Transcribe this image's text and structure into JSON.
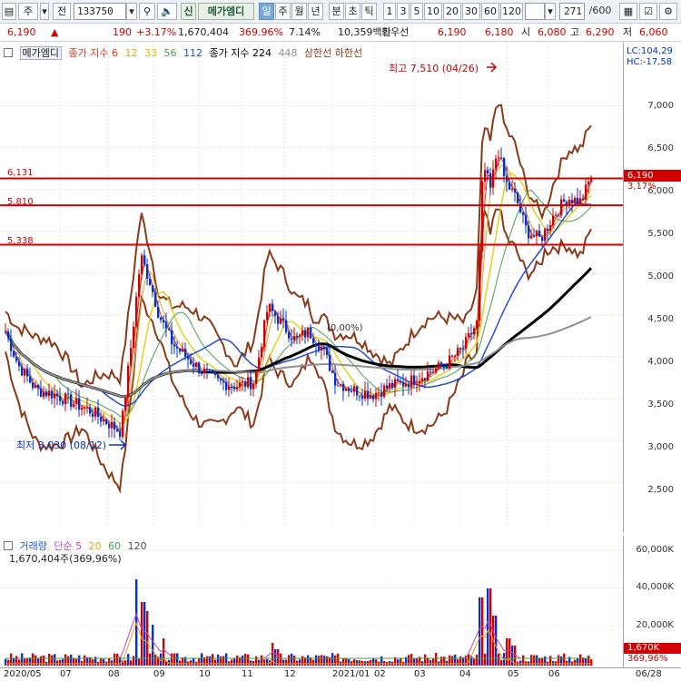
{
  "toolbar": {
    "type_label": "주",
    "market_label": "전",
    "code": "133750",
    "sign_label": "신",
    "stock_name": "메가엠디",
    "period_buttons": [
      "일",
      "주",
      "월",
      "년",
      "분",
      "초",
      "틱"
    ],
    "active_period": "일",
    "minute_buttons": [
      "1",
      "3",
      "5",
      "10",
      "20",
      "30",
      "60",
      "120"
    ],
    "count_value": "271",
    "count_total": "/600"
  },
  "quote": {
    "price": "6,190",
    "change": "190",
    "change_pct": "+3.17%",
    "volume": "1,670,404",
    "volume_ratio": "369.96%",
    "turnover": "7.14%",
    "amount": "10,359백만",
    "best_ask_label": "최우선",
    "best_ask": "6,190",
    "best_bid": "6,180",
    "open_label": "시",
    "open": "6,080",
    "high_label": "고",
    "high": "6,290",
    "low_label": "저",
    "low": "6,060"
  },
  "price_legend": {
    "name": "메가엠디",
    "ma_label": "종가 지수 6",
    "ma2": "12",
    "ma3": "33",
    "ma4": "56",
    "ma5": "112",
    "ma_long_label": "종가 지수 224",
    "ma7": "448",
    "limit_label": "상한선 하한선"
  },
  "price_info": {
    "lc": "LC:104,29",
    "hc": "HC:-17,58"
  },
  "annotations": {
    "high_text": "최고 7,510 (04/26)",
    "low_text": "최저 3,030 (08/12)",
    "center_text": "(0,00%)"
  },
  "lines": {
    "l1": "6,131",
    "l2": "5,810",
    "l3": "5,338"
  },
  "current_tag": {
    "price": "6,190",
    "pct": "3,17%"
  },
  "price_axis": [
    "7,000",
    "6,500",
    "6,000",
    "5,500",
    "5,000",
    "4,500",
    "4,000",
    "3,500",
    "3,000",
    "2,500"
  ],
  "volume_legend": {
    "label": "거래량",
    "ma_label": "단순 5",
    "ma2": "20",
    "ma3": "60",
    "ma4": "120",
    "value": "1,670,404주(369,96%)"
  },
  "volume_axis": [
    "60,000K",
    "40,000K",
    "20,000K"
  ],
  "volume_tag": {
    "value": "1,670K",
    "pct": "369,96%"
  },
  "xaxis": [
    "2020/05",
    "07",
    "08",
    "09",
    "10",
    "11",
    "12",
    "2021/01",
    "02",
    "03",
    "04",
    "05",
    "06",
    "06/28"
  ],
  "colors": {
    "up": "#d20000",
    "down": "#0033cc",
    "ma6": "#e8321e",
    "ma12": "#f0a020",
    "ma33": "#e8d020",
    "ma56": "#4aa050",
    "ma112": "#2050d0",
    "ma224": "#000000",
    "ma448": "#909090",
    "band": "#8b3a1a"
  },
  "chart_data": {
    "type": "candlestick",
    "ylim": [
      2000,
      7700
    ],
    "note": "approximate daily close path",
    "closes": [
      4200,
      4100,
      3850,
      3700,
      3600,
      3650,
      3800,
      3700,
      3600,
      3550,
      3500,
      3300,
      3200,
      3100,
      3050,
      3300,
      3800,
      4700,
      5100,
      4900,
      4600,
      4300,
      4100,
      3950,
      3900,
      3800,
      3700,
      3650,
      3700,
      3750,
      3900,
      4100,
      4400,
      4700,
      4900,
      4500,
      4200,
      4100,
      4000,
      4100,
      4300,
      4600,
      4500,
      4300,
      4100,
      3900,
      3800,
      3700,
      3600,
      3650,
      3700,
      3750,
      3800,
      3850,
      3900,
      3950,
      4000,
      4050,
      4100,
      4200,
      4300,
      4500,
      6400,
      6300,
      6000,
      5900,
      5800,
      5600,
      5500,
      5600,
      5700,
      5800,
      5900,
      6000,
      6100,
      6190
    ]
  }
}
